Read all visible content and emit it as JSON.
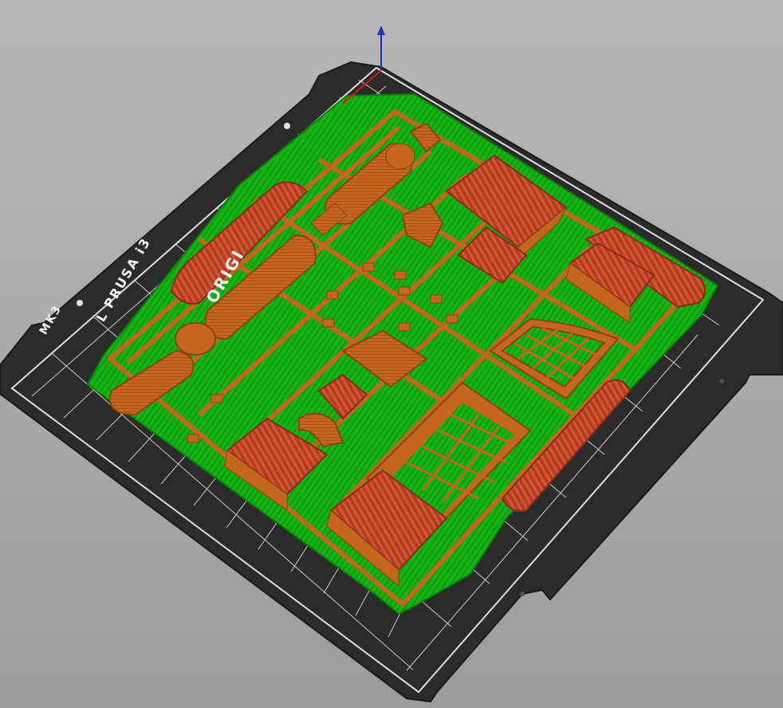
{
  "app": {
    "view": "3d-layer-preview"
  },
  "bed": {
    "logo_text": "ORIGINAL PRUSA i3 MK3",
    "logo_lines": [
      "ORIGI",
      "L PRUSA i3",
      "MK3"
    ],
    "sheet_color": "#2a2a2a",
    "grid_color": "#e8e8e8"
  },
  "colors": {
    "perimeter": "#c0601c",
    "infill": "#b23a2c",
    "support": "#16c016",
    "support_dark": "#0e8a10",
    "axis_z": "#1a2fd0",
    "axis_x": "#d01a1a",
    "axis_y": "#1ab01a"
  },
  "axes": {
    "z_label": "",
    "icons": [
      "z-axis-arrow-icon",
      "x-axis-line-icon",
      "y-axis-line-icon"
    ]
  }
}
